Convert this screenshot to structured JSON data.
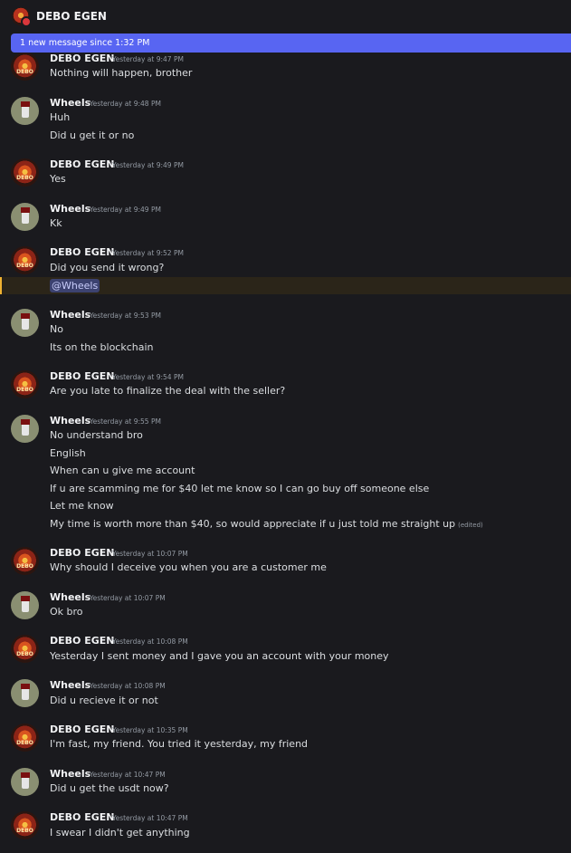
{
  "header": {
    "title": "DEBO EGEN"
  },
  "banner": {
    "text": "1 new message since 1:32 PM"
  },
  "messages": [
    {
      "author": "DEBO EGEN",
      "time": "Yesterday at 9:47 PM",
      "lines": [
        "Nothing will happen, brother"
      ]
    },
    {
      "author": "Wheels",
      "time": "Yesterday at 9:48 PM",
      "lines": [
        "Huh",
        "Did u get it or no"
      ]
    },
    {
      "author": "DEBO EGEN",
      "time": "Yesterday at 9:49 PM",
      "lines": [
        "Yes"
      ]
    },
    {
      "author": "Wheels",
      "time": "Yesterday at 9:49 PM",
      "lines": [
        "Kk"
      ]
    },
    {
      "author": "DEBO EGEN",
      "time": "Yesterday at 9:52 PM",
      "lines": [
        "Did you send it wrong?"
      ],
      "mention": "@Wheels"
    },
    {
      "author": "Wheels",
      "time": "Yesterday at 9:53 PM",
      "lines": [
        "No",
        "Its on the blockchain"
      ]
    },
    {
      "author": "DEBO EGEN",
      "time": "Yesterday at 9:54 PM",
      "lines": [
        "Are you late to finalize the deal with the seller?"
      ]
    },
    {
      "author": "Wheels",
      "time": "Yesterday at 9:55 PM",
      "lines": [
        "No understand bro",
        "English",
        "When can u give me account",
        "If u are scamming me for $40 let me know so I can go buy off someone else",
        "Let me know",
        "My time is worth more than $40, so would appreciate if u just told me straight up"
      ],
      "edited": "(edited)"
    },
    {
      "author": "DEBO EGEN",
      "time": "Yesterday at 10:07 PM",
      "lines": [
        "Why should I deceive you when you are a customer me"
      ]
    },
    {
      "author": "Wheels",
      "time": "Yesterday at 10:07 PM",
      "lines": [
        "Ok bro"
      ]
    },
    {
      "author": "DEBO EGEN",
      "time": "Yesterday at 10:08 PM",
      "lines": [
        "Yesterday I sent money and I gave you an account with your money"
      ]
    },
    {
      "author": "Wheels",
      "time": "Yesterday at 10:08 PM",
      "lines": [
        "Did u recieve it or not"
      ]
    },
    {
      "author": "DEBO EGEN",
      "time": "Yesterday at 10:35 PM",
      "lines": [
        "I'm fast, my friend. You tried it yesterday, my friend"
      ]
    },
    {
      "author": "Wheels",
      "time": "Yesterday at 10:47 PM",
      "lines": [
        "Did u get the usdt now?"
      ]
    },
    {
      "author": "DEBO EGEN",
      "time": "Yesterday at 10:47 PM",
      "lines": [
        "I swear I didn't get anything"
      ]
    }
  ]
}
